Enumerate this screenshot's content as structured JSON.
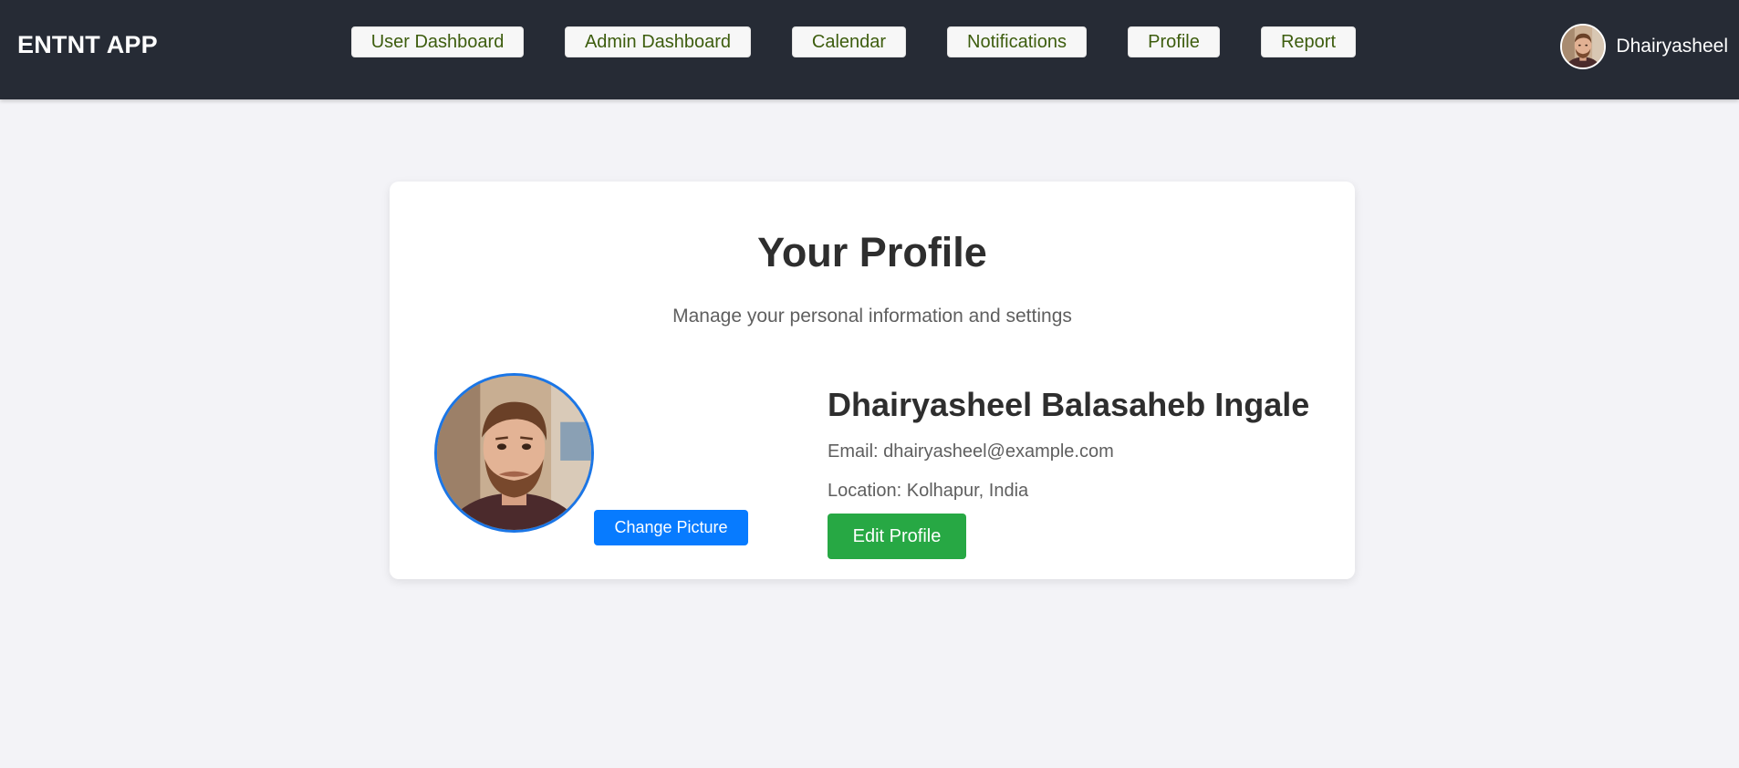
{
  "navbar": {
    "brand": "ENTNT APP",
    "links": [
      {
        "label": "User Dashboard"
      },
      {
        "label": "Admin Dashboard"
      },
      {
        "label": "Calendar"
      },
      {
        "label": "Notifications"
      },
      {
        "label": "Profile"
      },
      {
        "label": "Report"
      }
    ],
    "user": {
      "name": "Dhairyasheel",
      "avatar_icon": "user-avatar-photo"
    }
  },
  "profile": {
    "title": "Your Profile",
    "subtitle": "Manage your personal information and settings",
    "full_name": "Dhairyasheel Balasaheb Ingale",
    "email_text": "Email: dhairyasheel@example.com",
    "location_text": "Location: Kolhapur, India",
    "change_picture_label": "Change Picture",
    "edit_label": "Edit Profile",
    "picture_icon": "profile-photo"
  },
  "colors": {
    "navbar_bg": "#262b35",
    "page_bg": "#f3f3f7",
    "nav_link_text": "#3d5d0e",
    "primary_blue": "#077bff",
    "success_green": "#27a844",
    "avatar_ring": "#1b76e6"
  }
}
